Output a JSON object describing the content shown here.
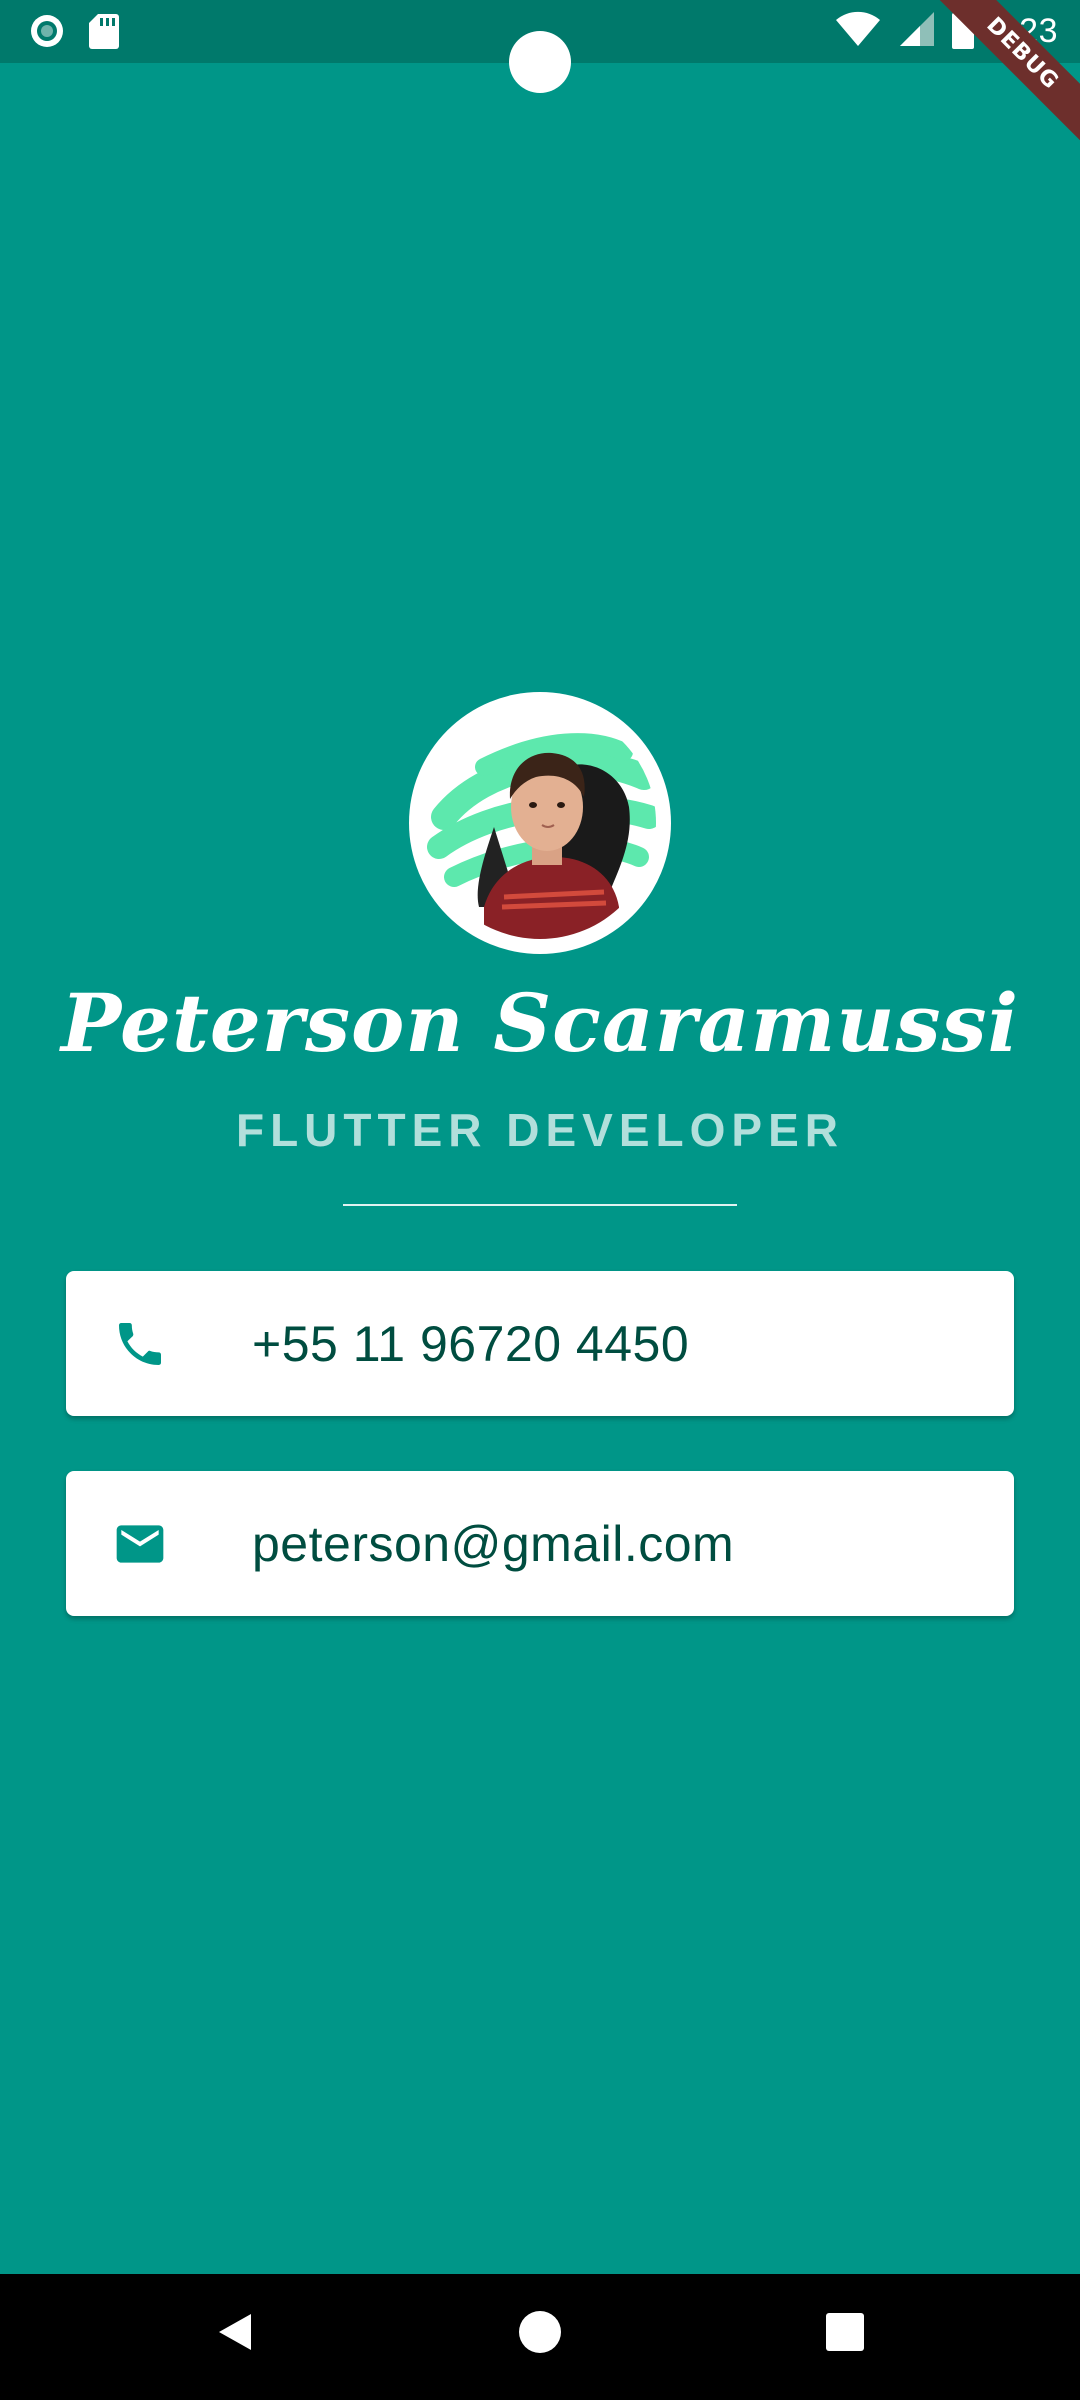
{
  "status_bar": {
    "time": "7:23",
    "left_icons": [
      "record-icon",
      "sd-card-icon"
    ],
    "right_icons": [
      "wifi-icon",
      "signal-icon",
      "battery-icon"
    ]
  },
  "debug_banner": "DEBUG",
  "profile": {
    "name": "Peterson Scaramussi",
    "title": "FLUTTER DEVELOPER"
  },
  "contacts": {
    "phone": {
      "icon": "phone-icon",
      "value": "+55 11 96720 4450"
    },
    "email": {
      "icon": "mail-icon",
      "value": "peterson@gmail.com"
    }
  },
  "colors": {
    "background": "#009688",
    "status_bar": "#00796B",
    "title": "#B2DFDB",
    "card_text": "#004D40",
    "icon": "#009688",
    "debug": "#6d2f2c"
  },
  "nav_bar": {
    "buttons": [
      "back-icon",
      "home-icon",
      "recents-icon"
    ]
  }
}
